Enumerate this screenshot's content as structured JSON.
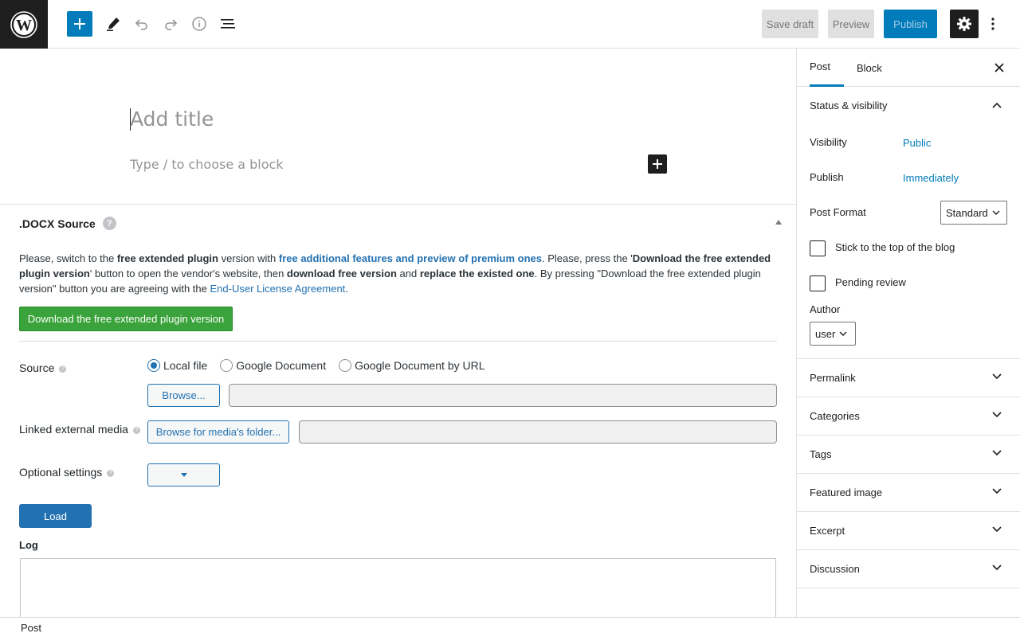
{
  "toolbar": {
    "save_draft": "Save draft",
    "preview": "Preview",
    "publish": "Publish",
    "icons": [
      "wordpress-logo-icon",
      "plus-icon",
      "pencil-icon",
      "undo-icon",
      "redo-icon",
      "info-icon",
      "list-view-icon",
      "gear-icon",
      "more-vertical-icon"
    ]
  },
  "editor": {
    "title_placeholder": "Add title",
    "block_placeholder": "Type / to choose a block"
  },
  "docx": {
    "title": ".DOCX Source",
    "help": "?",
    "notice": {
      "t1": "Please, switch to the ",
      "b1": "free extended plugin",
      "t2": " version with ",
      "link1": "free additional features and preview of premium ones",
      "t3": ". Please, press the '",
      "b2": "Download the free extended plugin version",
      "t4": "' button to open the vendor's website, then ",
      "b3": "download free version",
      "t5": " and ",
      "b4": "replace the existed one",
      "t6": ". By pressing \"Download the free extended plugin version\" button you are agreeing with the ",
      "link2": "End-User License Agreement",
      "t7": "."
    },
    "download_button": "Download the free extended plugin version",
    "source_label": "Source",
    "source_options": [
      "Local file",
      "Google Document",
      "Google Document by URL"
    ],
    "source_selected": "Local file",
    "browse_button": "Browse...",
    "linked_media_label": "Linked external media",
    "browse_media_button": "Browse for media's folder...",
    "optional_settings_label": "Optional settings",
    "load_button": "Load",
    "log_label": "Log"
  },
  "sidebar": {
    "tabs": [
      "Post",
      "Block"
    ],
    "active_tab": "Post",
    "status_visibility": {
      "title": "Status & visibility",
      "visibility_label": "Visibility",
      "visibility_value": "Public",
      "publish_label": "Publish",
      "publish_value": "Immediately",
      "post_format_label": "Post Format",
      "post_format_value": "Standard",
      "stick_label": "Stick to the top of the blog",
      "pending_label": "Pending review",
      "author_label": "Author",
      "author_value": "user"
    },
    "panels": [
      "Permalink",
      "Categories",
      "Tags",
      "Featured image",
      "Excerpt",
      "Discussion"
    ]
  },
  "footer": {
    "breadcrumb": "Post"
  },
  "colors": {
    "accent": "#007cba",
    "link": "#2271b1",
    "download_green": "#3ba33b"
  }
}
